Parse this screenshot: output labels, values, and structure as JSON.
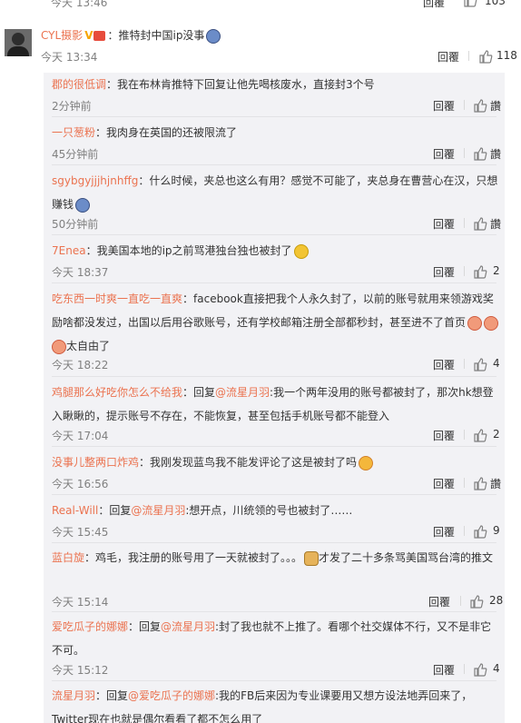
{
  "top_fragment": {
    "time": "今天 13:46",
    "reply": "回覆",
    "likes": "103"
  },
  "main": {
    "username": "CYL摄影",
    "text": "：推特封中国ip没事",
    "time": "今天 13:34",
    "reply": "回覆",
    "likes": "118"
  },
  "replies": [
    {
      "name": "郡的很低调",
      "text": "：我在布林肯推特下回复让他先喝核废水，直接封3个号",
      "time": "2分钟前",
      "reply": "回覆",
      "likes": "讚"
    },
    {
      "name": "一只葱粉",
      "text": "：我肉身在英国的还被限流了",
      "time": "45分钟前",
      "reply": "回覆",
      "likes": "讚"
    },
    {
      "name": "sgybgyjjjhjnhffg",
      "text": "：什么时候，夹总也这么有用？感觉不可能了，夹总身在曹营心在汉，只想赚钱",
      "time": "50分钟前",
      "reply": "回覆",
      "likes": "讚"
    },
    {
      "name": "7Enea",
      "text": "：我美国本地的ip之前骂港独台独也被封了",
      "time": "今天 18:37",
      "reply": "回覆",
      "likes": "2"
    },
    {
      "name": "吃东西一时爽一直吃一直爽",
      "text": "：facebook直接把我个人永久封了，以前的账号就用来领游戏奖励啥都没发过，出国以后用谷歌账号，还有学校邮箱注册全部都秒封，甚至进不了首页",
      "text_tail": "太自由了",
      "time": "今天 18:22",
      "reply": "回覆",
      "likes": "4"
    },
    {
      "name": "鸡腿那么好吃你怎么不给我",
      "pre": "：回复",
      "at": "@流星月羽",
      "text": ":我一个两年没用的账号都被封了，那次hk想登入瞅瞅的，提示账号不存在，不能恢复，甚至包括手机账号都不能登入",
      "time": "今天 17:04",
      "reply": "回覆",
      "likes": "2"
    },
    {
      "name": "没事儿整两口炸鸡",
      "text": "：我刚发现蓝鸟我不能发评论了这是被封了吗",
      "time": "今天 16:56",
      "reply": "回覆",
      "likes": "讚"
    },
    {
      "name": "Real-Will",
      "pre": "：回复",
      "at": "@流星月羽",
      "text": ":想开点，川统领的号也被封了……",
      "time": "今天 15:45",
      "reply": "回覆",
      "likes": "9"
    },
    {
      "name": "蓝白旋",
      "text": "：鸡毛，我注册的账号用了一天就被封了。。。",
      "text2": "才发了二十多条骂美国骂台湾的推文",
      "time": "今天 15:14",
      "reply": "回覆",
      "likes": "28"
    },
    {
      "name": "爱吃瓜子的娜娜",
      "pre": "：回复",
      "at": "@流星月羽",
      "text": ":封了我也就不上推了。看哪个社交媒体不行，又不是非它不可。",
      "time": "今天 15:12",
      "reply": "回覆",
      "likes": "4"
    },
    {
      "name": "流星月羽",
      "pre": "：回复",
      "at": "@爱吃瓜子的娜娜",
      "text": ":我的FB后来因为专业课要用又想方设法地弄回来了，Twitter现在也就是偶尔看看了都不怎么用了"
    }
  ]
}
